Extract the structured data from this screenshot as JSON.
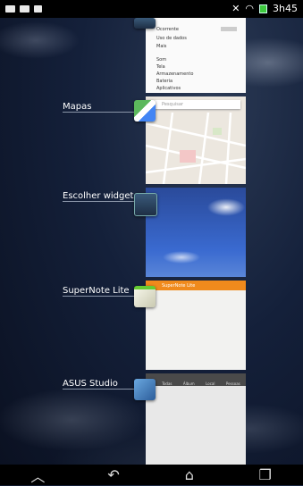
{
  "status_bar": {
    "time": "3h45",
    "left_icons": [
      "screenshot-icon",
      "notification-icon",
      "file-icon"
    ],
    "right_icons": [
      "mute-icon",
      "wifi-icon",
      "battery-icon"
    ]
  },
  "recent_apps": [
    {
      "label": "",
      "icon": "settings-icon",
      "thumb": "settings",
      "thumb_rows": [
        "Ocorrente",
        "Uso de dados",
        "Mais",
        "Som",
        "Tela",
        "Armazenamento",
        "Bateria",
        "Aplicativos"
      ]
    },
    {
      "label": "Mapas",
      "icon": "maps-icon",
      "thumb": "map",
      "search_placeholder": "Pesquisar"
    },
    {
      "label": "Escolher widget",
      "icon": "widget-icon",
      "thumb": "sky"
    },
    {
      "label": "SuperNote Lite",
      "icon": "supernote-icon",
      "thumb": "notes",
      "header_text": "SuperNote Lite"
    },
    {
      "label": "ASUS Studio",
      "icon": "asus-studio-icon",
      "thumb": "gallery",
      "tabs": [
        "Todas",
        "Álbum",
        "Local",
        "Pessoas"
      ]
    }
  ],
  "nav_bar": {
    "buttons": [
      "collapse-icon",
      "back-icon",
      "home-icon",
      "recent-apps-icon"
    ]
  }
}
